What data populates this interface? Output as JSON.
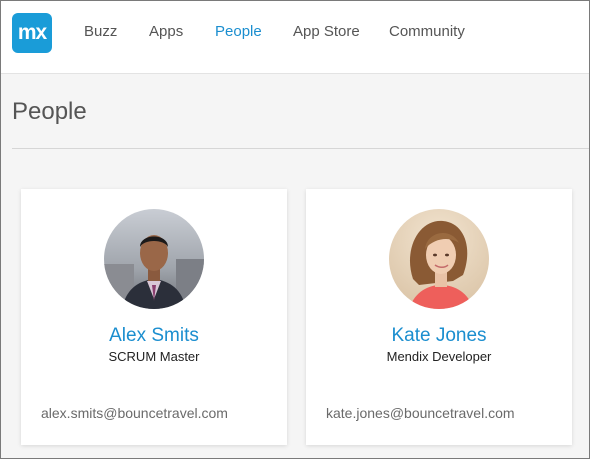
{
  "app": {
    "logo_text": "mx",
    "brand_color": "#1a9cd8",
    "accent_color": "#1b8ecf"
  },
  "nav": {
    "items": [
      {
        "label": "Buzz",
        "active": false
      },
      {
        "label": "Apps",
        "active": false
      },
      {
        "label": "People",
        "active": true
      },
      {
        "label": "App Store",
        "active": false
      },
      {
        "label": "Community",
        "active": false
      }
    ]
  },
  "page": {
    "title": "People"
  },
  "people": [
    {
      "name": "Alex Smits",
      "role": "SCRUM Master",
      "email": "alex.smits@bouncetravel.com",
      "avatar_icon": "avatar-photo-man"
    },
    {
      "name": "Kate Jones",
      "role": "Mendix Developer",
      "email": "kate.jones@bouncetravel.com",
      "avatar_icon": "avatar-photo-woman"
    }
  ]
}
